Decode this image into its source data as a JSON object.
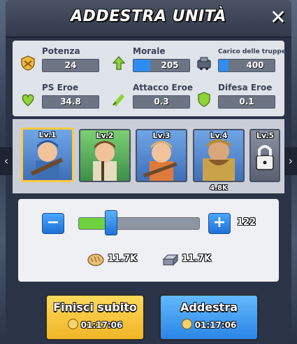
{
  "window": {
    "title": "ADDESTRA UNITÀ",
    "close_icon": "close-icon"
  },
  "stats": [
    {
      "label": "Potenza",
      "value": "24",
      "icon": "shield-power-icon"
    },
    {
      "label": "Morale",
      "value": "205",
      "icon": "morale-arrow-icon"
    },
    {
      "label": "Carico delle truppe",
      "value": "400",
      "icon": "cart-load-icon"
    },
    {
      "label": "PS Eroe",
      "value": "34.8",
      "icon": "hero-hp-icon"
    },
    {
      "label": "Attacco Eroe",
      "value": "0.3",
      "icon": "hero-attack-icon"
    },
    {
      "label": "Difesa Eroe",
      "value": "0.1",
      "icon": "hero-defense-icon"
    }
  ],
  "units": [
    {
      "level": "Lv.1",
      "selected": true,
      "locked": false
    },
    {
      "level": "Lv.2",
      "selected": false,
      "locked": false
    },
    {
      "level": "Lv.3",
      "selected": false,
      "locked": false
    },
    {
      "level": "Lv.4",
      "selected": false,
      "locked": false,
      "cost": "4.8K"
    },
    {
      "level": "Lv.5",
      "selected": false,
      "locked": true
    }
  ],
  "quantity": {
    "value": "122",
    "slider_fraction": 0.27
  },
  "resources": [
    {
      "icon": "bread-icon",
      "value": "11.7K"
    },
    {
      "icon": "iron-ingot-icon",
      "value": "11.7K"
    }
  ],
  "actions": {
    "finish_now": {
      "label": "Finisci subito",
      "time": "01:17:06"
    },
    "train": {
      "label": "Addestra",
      "time": "01:17:06"
    }
  },
  "colors": {
    "accent_blue": "#2f8cf0",
    "slider_green": "#6fd23f",
    "select_gold": "#ffc93c"
  }
}
